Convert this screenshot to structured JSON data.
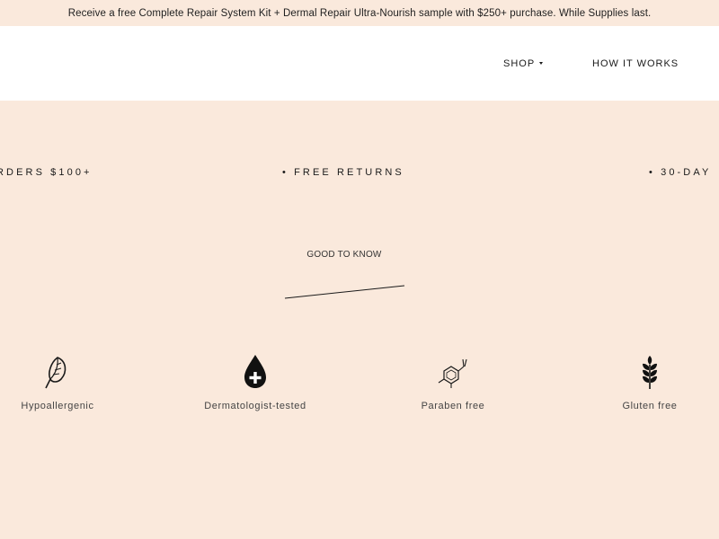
{
  "announcement": {
    "text": "Receive a free Complete Repair System Kit + Dermal Repair Ultra-Nourish sample with $250+ purchase. While Supplies last."
  },
  "nav": {
    "shop_label": "SHOP",
    "how_label": "HOW IT WORKS"
  },
  "marquee": {
    "items": [
      "RDERS $100+",
      "• FREE RETURNS",
      "• 30-DAY"
    ]
  },
  "good_to_know": {
    "heading": "GOOD TO KNOW"
  },
  "features": [
    {
      "icon": "leaf-icon",
      "label": "Hypoallergenic"
    },
    {
      "icon": "drop-plus-icon",
      "label": "Dermatologist-tested"
    },
    {
      "icon": "molecule-icon",
      "label": "Paraben free"
    },
    {
      "icon": "wheat-icon",
      "label": "Gluten free"
    }
  ],
  "colors": {
    "background": "#fae9dc",
    "header": "#ffffff",
    "text": "#1a1a1a"
  }
}
